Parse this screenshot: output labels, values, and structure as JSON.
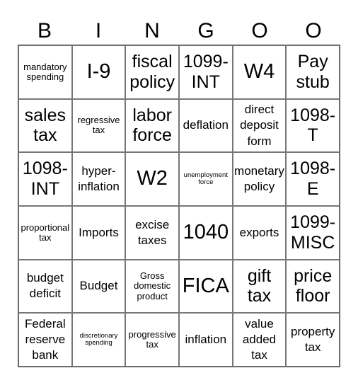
{
  "header": [
    "B",
    "I",
    "N",
    "G",
    "O",
    "O"
  ],
  "cells": [
    {
      "text": "mandatory spending",
      "size": "s-s"
    },
    {
      "text": "I-9",
      "size": "s-xl"
    },
    {
      "text": "fiscal policy",
      "size": "s-l"
    },
    {
      "text": "1099-INT",
      "size": "s-l"
    },
    {
      "text": "W4",
      "size": "s-xl"
    },
    {
      "text": "Pay stub",
      "size": "s-l"
    },
    {
      "text": "sales tax",
      "size": "s-l"
    },
    {
      "text": "regressive tax",
      "size": "s-s"
    },
    {
      "text": "labor force",
      "size": "s-l"
    },
    {
      "text": "deflation",
      "size": "s-m"
    },
    {
      "text": "direct deposit form",
      "size": "s-m"
    },
    {
      "text": "1098-T",
      "size": "s-l"
    },
    {
      "text": "1098-INT",
      "size": "s-l"
    },
    {
      "text": "hyper-inflation",
      "size": "s-m"
    },
    {
      "text": "W2",
      "size": "s-xl"
    },
    {
      "text": "unemployment force",
      "size": "s-xs"
    },
    {
      "text": "monetary policy",
      "size": "s-m"
    },
    {
      "text": "1098-E",
      "size": "s-l"
    },
    {
      "text": "proportional tax",
      "size": "s-s"
    },
    {
      "text": "Imports",
      "size": "s-m"
    },
    {
      "text": "excise taxes",
      "size": "s-m"
    },
    {
      "text": "1040",
      "size": "s-xl"
    },
    {
      "text": "exports",
      "size": "s-m"
    },
    {
      "text": "1099-MISC",
      "size": "s-l"
    },
    {
      "text": "budget deficit",
      "size": "s-m"
    },
    {
      "text": "Budget",
      "size": "s-m"
    },
    {
      "text": "Gross domestic product",
      "size": "s-s"
    },
    {
      "text": "FICA",
      "size": "s-xl"
    },
    {
      "text": "gift tax",
      "size": "s-l"
    },
    {
      "text": "price floor",
      "size": "s-l"
    },
    {
      "text": "Federal reserve bank",
      "size": "s-m"
    },
    {
      "text": "discretionary spending",
      "size": "s-xs"
    },
    {
      "text": "progressive tax",
      "size": "s-s"
    },
    {
      "text": "inflation",
      "size": "s-m"
    },
    {
      "text": "value added tax",
      "size": "s-m"
    },
    {
      "text": "property tax",
      "size": "s-m"
    }
  ]
}
